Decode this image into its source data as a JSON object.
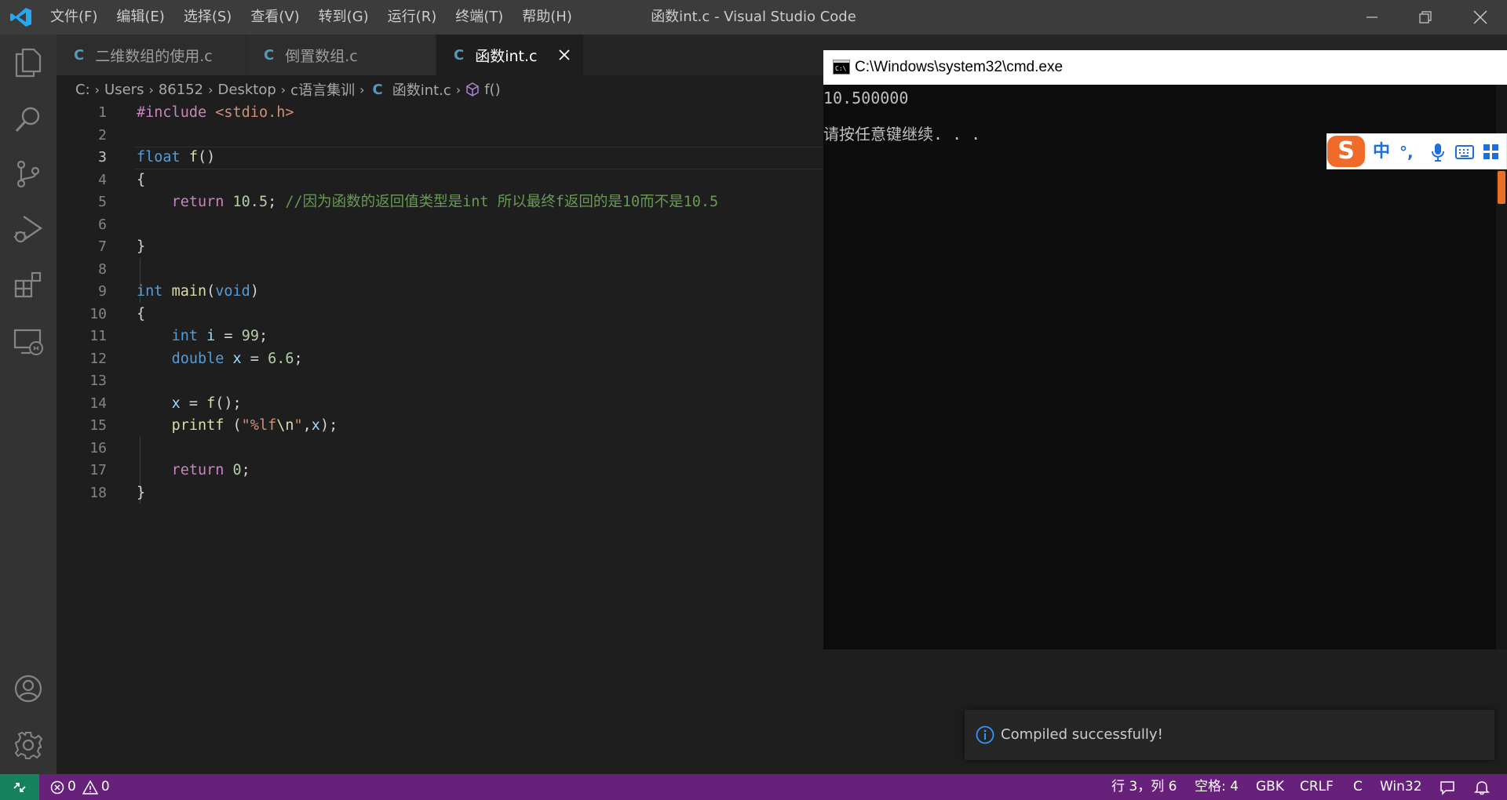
{
  "window": {
    "title": "函数int.c - Visual Studio Code"
  },
  "menu": [
    "文件(F)",
    "编辑(E)",
    "选择(S)",
    "查看(V)",
    "转到(G)",
    "运行(R)",
    "终端(T)",
    "帮助(H)"
  ],
  "tabs": [
    {
      "label": "二维数组的使用.c",
      "active": false
    },
    {
      "label": "倒置数组.c",
      "active": false
    },
    {
      "label": "函数int.c",
      "active": true
    }
  ],
  "breadcrumb": [
    "C:",
    "Users",
    "86152",
    "Desktop",
    "c语言集训",
    "函数int.c",
    "f()"
  ],
  "breadcrumb_icons": {
    "file": "c-file-icon",
    "symbol": "method-cube-icon"
  },
  "editor": {
    "current_line": 3,
    "line_numbers": [
      "1",
      "2",
      "3",
      "4",
      "5",
      "6",
      "7",
      "8",
      "9",
      "10",
      "11",
      "12",
      "13",
      "14",
      "15",
      "16",
      "17",
      "18"
    ],
    "lines": [
      [
        [
          "#include ",
          "k-pink"
        ],
        [
          "<stdio.h>",
          "k-str"
        ]
      ],
      [],
      [
        [
          "float",
          "k-blue"
        ],
        [
          " ",
          ""
        ],
        [
          "f",
          "k-yellow"
        ],
        [
          "()",
          ""
        ]
      ],
      [
        [
          "{",
          ""
        ]
      ],
      [
        [
          "    ",
          ""
        ],
        [
          "return",
          "k-pink"
        ],
        [
          " ",
          ""
        ],
        [
          "10.5",
          "k-num"
        ],
        [
          "; ",
          ""
        ],
        [
          "//因为函数的返回值类型是int 所以最终f返回的是10而不是10.5",
          "k-cmt"
        ]
      ],
      [],
      [
        [
          "}",
          ""
        ]
      ],
      [],
      [
        [
          "int",
          "k-blue"
        ],
        [
          " ",
          ""
        ],
        [
          "main",
          "k-yellow"
        ],
        [
          "(",
          ""
        ],
        [
          "void",
          "k-blue"
        ],
        [
          ")",
          ""
        ]
      ],
      [
        [
          "{",
          ""
        ]
      ],
      [
        [
          "    ",
          ""
        ],
        [
          "int",
          "k-blue"
        ],
        [
          " ",
          ""
        ],
        [
          "i",
          "k-var"
        ],
        [
          " = ",
          ""
        ],
        [
          "99",
          "k-num"
        ],
        [
          ";",
          ""
        ]
      ],
      [
        [
          "    ",
          ""
        ],
        [
          "double",
          "k-blue"
        ],
        [
          " ",
          ""
        ],
        [
          "x",
          "k-var"
        ],
        [
          " = ",
          ""
        ],
        [
          "6.6",
          "k-num"
        ],
        [
          ";",
          ""
        ]
      ],
      [],
      [
        [
          "    ",
          ""
        ],
        [
          "x",
          "k-var"
        ],
        [
          " = ",
          ""
        ],
        [
          "f",
          "k-yellow"
        ],
        [
          "();",
          ""
        ]
      ],
      [
        [
          "    ",
          ""
        ],
        [
          "printf",
          "k-yellow"
        ],
        [
          " (",
          ""
        ],
        [
          "\"%lf",
          "k-str"
        ],
        [
          "\\n",
          "k-yellow"
        ],
        [
          "\"",
          "k-str"
        ],
        [
          ",",
          ""
        ],
        [
          "x",
          "k-var"
        ],
        [
          ");",
          ""
        ]
      ],
      [],
      [
        [
          "    ",
          ""
        ],
        [
          "return",
          "k-pink"
        ],
        [
          " ",
          ""
        ],
        [
          "0",
          "k-num"
        ],
        [
          ";",
          ""
        ]
      ],
      [
        [
          "}",
          ""
        ]
      ]
    ]
  },
  "cmd": {
    "title": "C:\\Windows\\system32\\cmd.exe",
    "output_line1": "10.500000",
    "output_line2": "请按任意键继续. . ."
  },
  "ime": {
    "logo": "S",
    "mode": "中",
    "punct": "°,"
  },
  "notification": {
    "text": "Compiled successfully!"
  },
  "status": {
    "errors": "0",
    "warnings": "0",
    "position": "行 3，列 6",
    "spaces": "空格: 4",
    "encoding": "GBK",
    "eol": "CRLF",
    "language": "C",
    "platform": "Win32"
  },
  "colors": {
    "statusbar": "#68217a",
    "remote": "#16825d",
    "accent": "#007acc",
    "ime_logo": "#f06a2a"
  }
}
